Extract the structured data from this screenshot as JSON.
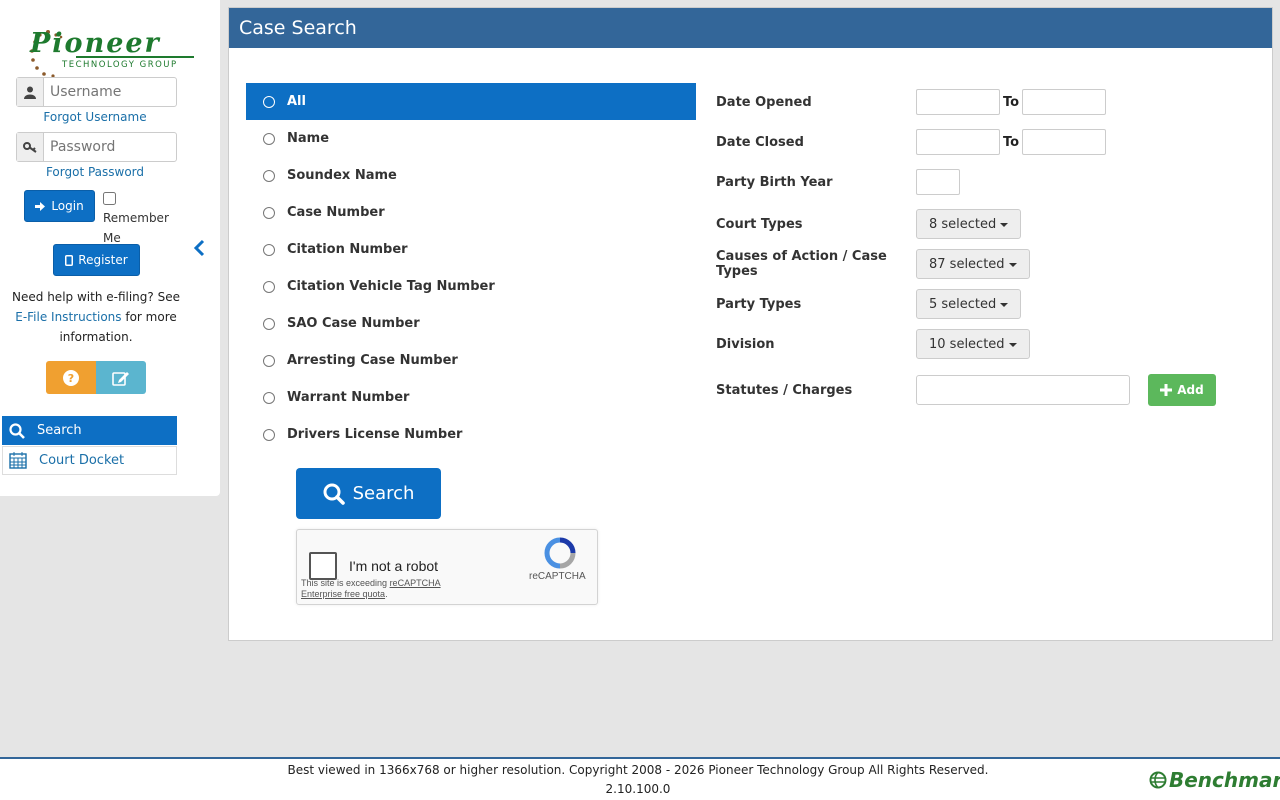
{
  "sidebar": {
    "logo": {
      "name": "Pioneer",
      "tagline": "TECHNOLOGY GROUP"
    },
    "username_placeholder": "Username",
    "forgot_username": "Forgot Username",
    "password_placeholder": "Password",
    "forgot_password": "Forgot Password",
    "login_label": "Login",
    "remember_label": "Remember Me",
    "register_label": "Register",
    "help_prefix": "Need help with e-filing? See",
    "help_link": "E-File Instructions",
    "help_suffix": "for more information.",
    "nav": [
      {
        "label": "Search",
        "icon": "search-icon",
        "active": true
      },
      {
        "label": "Court Docket",
        "icon": "calendar-icon",
        "active": false
      }
    ]
  },
  "panel": {
    "title": "Case Search",
    "search_types": [
      {
        "label": "All",
        "selected": true
      },
      {
        "label": "Name"
      },
      {
        "label": "Soundex Name"
      },
      {
        "label": "Case Number"
      },
      {
        "label": "Citation Number"
      },
      {
        "label": "Citation Vehicle Tag Number"
      },
      {
        "label": "SAO Case Number"
      },
      {
        "label": "Arresting Case Number"
      },
      {
        "label": "Warrant Number"
      },
      {
        "label": "Drivers License Number"
      }
    ],
    "search_button": "Search",
    "captcha": {
      "label": "I'm not a robot",
      "note_prefix": "This site is exceeding",
      "note_link": "reCAPTCHA Enterprise free quota",
      "brand": "reCAPTCHA"
    },
    "filters": {
      "date_opened": "Date Opened",
      "date_closed": "Date Closed",
      "to": "To",
      "party_birth_year": "Party Birth Year",
      "court_types": {
        "label": "Court Types",
        "value": "8 selected"
      },
      "causes": {
        "label": "Causes of Action / Case Types",
        "value": "87 selected"
      },
      "party_types": {
        "label": "Party Types",
        "value": "5 selected"
      },
      "division": {
        "label": "Division",
        "value": "10 selected"
      },
      "statutes": "Statutes / Charges",
      "add_button": "Add"
    }
  },
  "footer": {
    "copyright": "Best viewed in 1366x768 or higher resolution. Copyright 2008 - 2026 Pioneer Technology Group All Rights Reserved.",
    "version": "2.10.100.0",
    "brand": "Benchmark"
  },
  "colors": {
    "primary": "#0d6fc4",
    "header": "#336699",
    "success": "#5cb85c",
    "warning": "#f0a030",
    "info": "#5bb5cf",
    "logo_green": "#1e7a2e"
  }
}
